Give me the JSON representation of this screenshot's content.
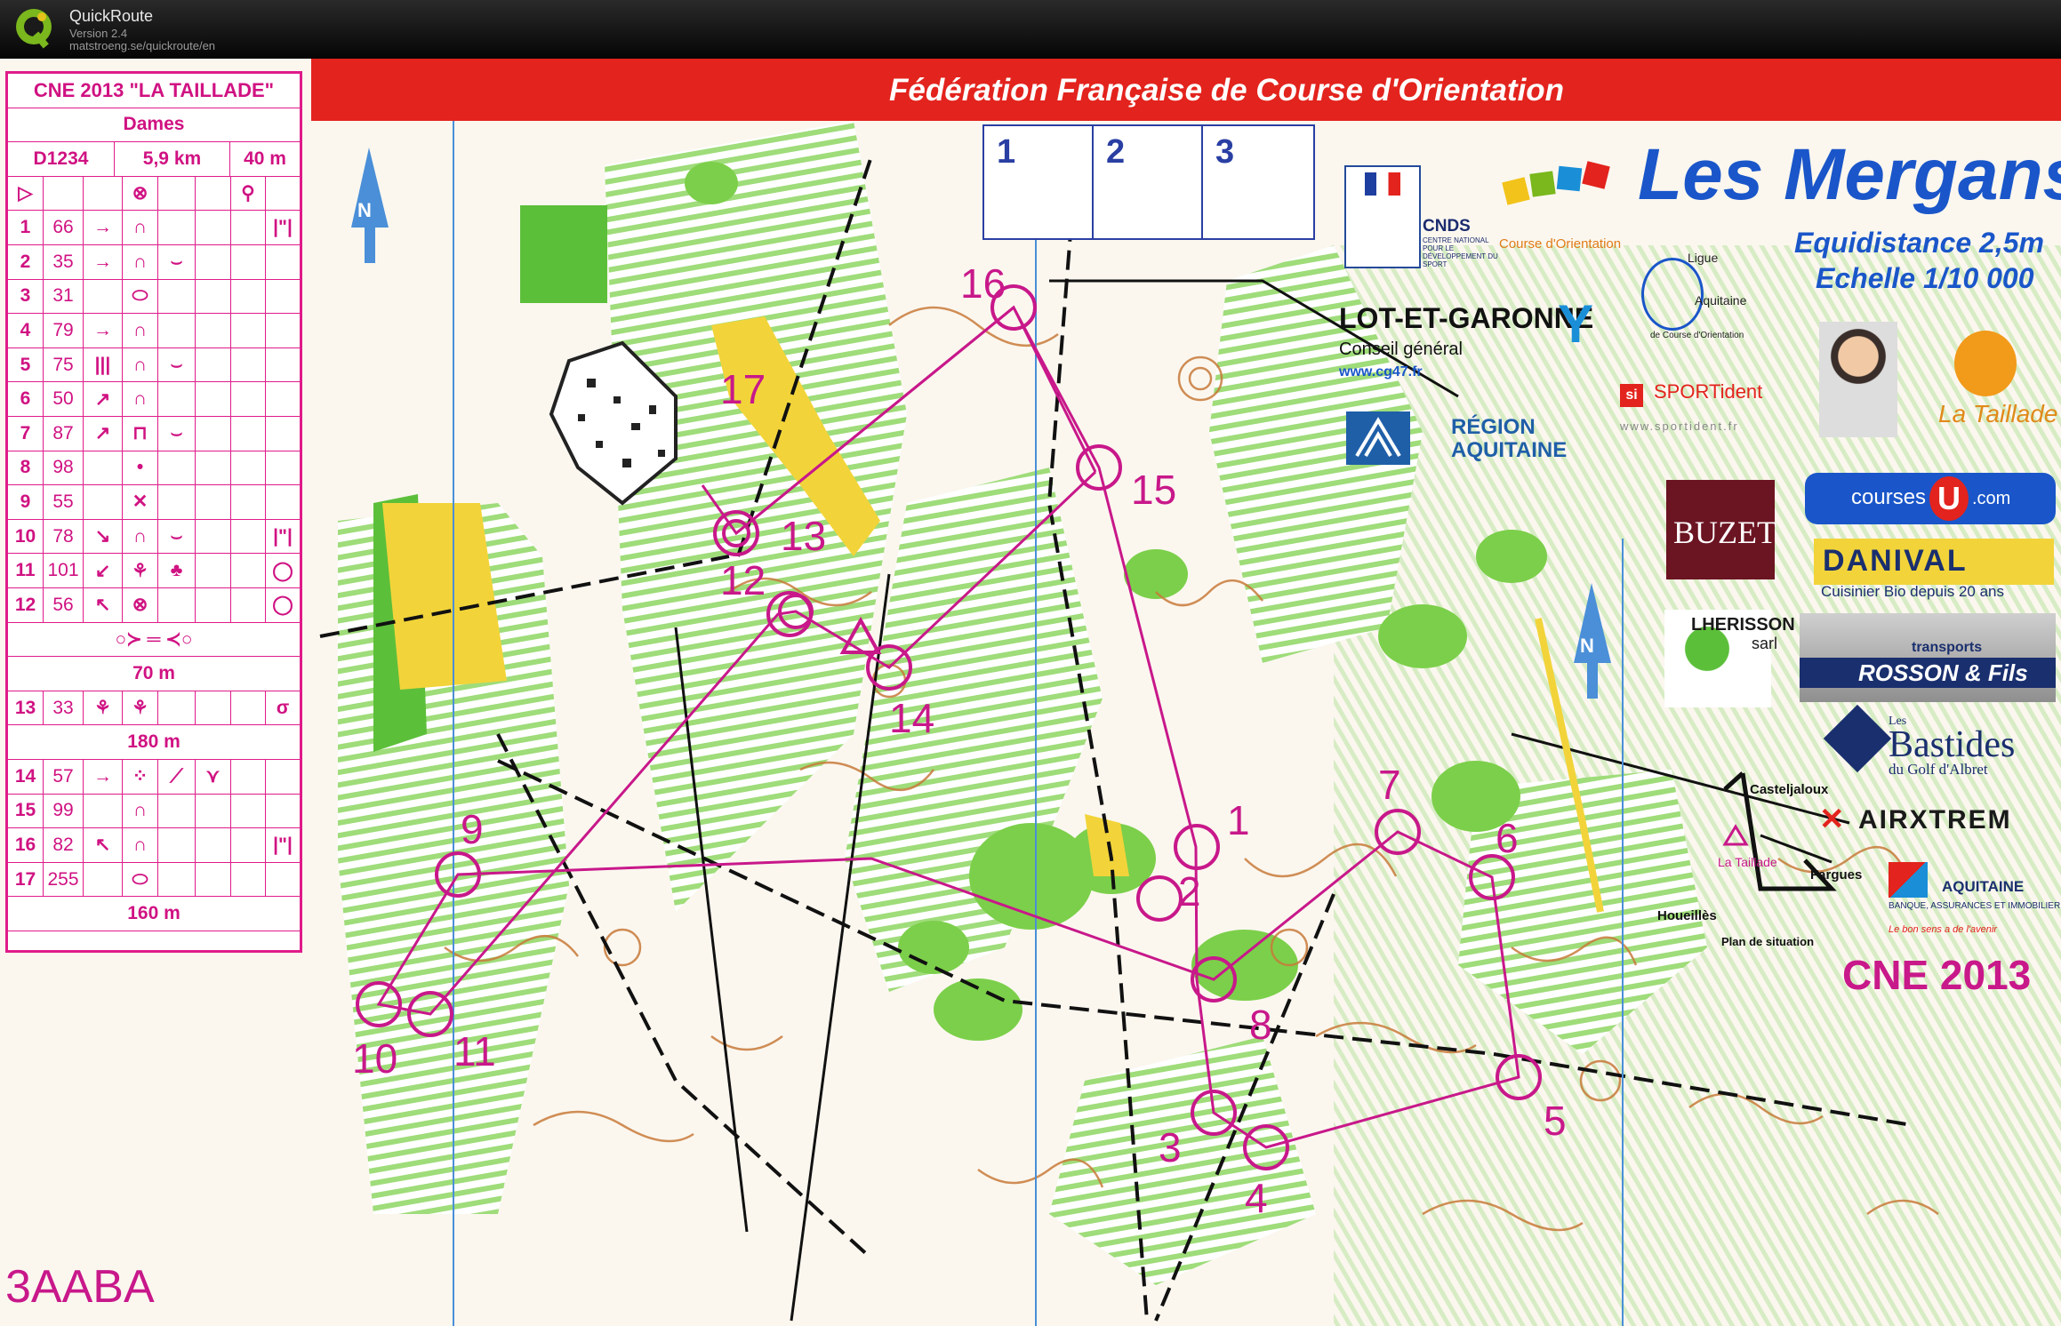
{
  "app": {
    "name": "QuickRoute",
    "version": "Version 2.4",
    "url": "matstroeng.se/quickroute/en"
  },
  "course": {
    "event": "CNE 2013 \"LA TAILLADE\"",
    "category": "Dames",
    "code": "D1234",
    "length": "5,9 km",
    "climb": "40 m",
    "controls": [
      {
        "n": "1",
        "code": "66"
      },
      {
        "n": "2",
        "code": "35"
      },
      {
        "n": "3",
        "code": "31"
      },
      {
        "n": "4",
        "code": "79"
      },
      {
        "n": "5",
        "code": "75"
      },
      {
        "n": "6",
        "code": "50"
      },
      {
        "n": "7",
        "code": "87"
      },
      {
        "n": "8",
        "code": "98"
      },
      {
        "n": "9",
        "code": "55"
      },
      {
        "n": "10",
        "code": "78"
      },
      {
        "n": "11",
        "code": "101"
      },
      {
        "n": "12",
        "code": "56"
      }
    ],
    "tape1": "70 m",
    "control13": {
      "n": "13",
      "code": "33"
    },
    "tape2": "180 m",
    "controls_late": [
      {
        "n": "14",
        "code": "57"
      },
      {
        "n": "15",
        "code": "99"
      },
      {
        "n": "16",
        "code": "82"
      },
      {
        "n": "17",
        "code": "255"
      }
    ],
    "tape3": "160 m",
    "map_code": "3AABA"
  },
  "header": {
    "federation": "Fédération Française de Course d'Orientation",
    "box_numbers": [
      "1",
      "2",
      "3"
    ],
    "club": "Les Mergans",
    "equidistance": "Equidistance 2,5m",
    "scale": "Echelle 1/10 000",
    "cne": "CNE 2013"
  },
  "sponsors": {
    "cnds": "CNDS",
    "cnds_sub": "CENTRE NATIONAL POUR LE DÉVELOPPEMENT DU SPORT",
    "ffco_sub": "Course d'Orientation",
    "lot_et_garonne": "LOT-ET-GARONNE",
    "conseil": "Conseil général",
    "cg47": "www.cg47.fr",
    "region": "RÉGION",
    "aquitaine": "AQUITAINE",
    "ligue": "Ligue",
    "ligue_aq": "Aquitaine",
    "ligue_sub": "de Course d'Orientation",
    "sportident": "SPORTident",
    "sportident_url": "www.sportident.fr",
    "taillade": "La Taillade",
    "courses": "courses",
    "courses_com": ".com",
    "buzet": "BUZET",
    "danival": "DANIVAL",
    "danival_sub": "Cuisinier Bio depuis 20 ans",
    "lherisson": "LHERISSON",
    "sarl": "sarl",
    "transports": "transports",
    "rosson": "ROSSON & Fils",
    "bastides": "Bastides",
    "bastides_les": "Les",
    "bastides_sub": "du Golf d'Albret",
    "airxtrem": "AIRXTREM",
    "ca": "AQUITAINE",
    "ca_sub": "BANQUE, ASSURANCES ET IMMOBILIER",
    "ca_slogan": "Le bon sens a de l'avenir"
  },
  "situation": {
    "casteljaloux": "Casteljaloux",
    "la_taillade": "La Taillade",
    "fargues": "Fargues",
    "houeilles": "Houeillès",
    "caption": "Plan de situation"
  },
  "control_labels": [
    "1",
    "2",
    "3",
    "4",
    "5",
    "6",
    "7",
    "8",
    "9",
    "10",
    "11",
    "12",
    "13",
    "14",
    "15",
    "16",
    "17"
  ],
  "colors": {
    "course": "#c8188a",
    "banner": "#e3231d",
    "blue": "#2a3fa3",
    "vegetation": "#7ccf4a",
    "open": "#f2d43a",
    "contour": "#c87a3a"
  }
}
